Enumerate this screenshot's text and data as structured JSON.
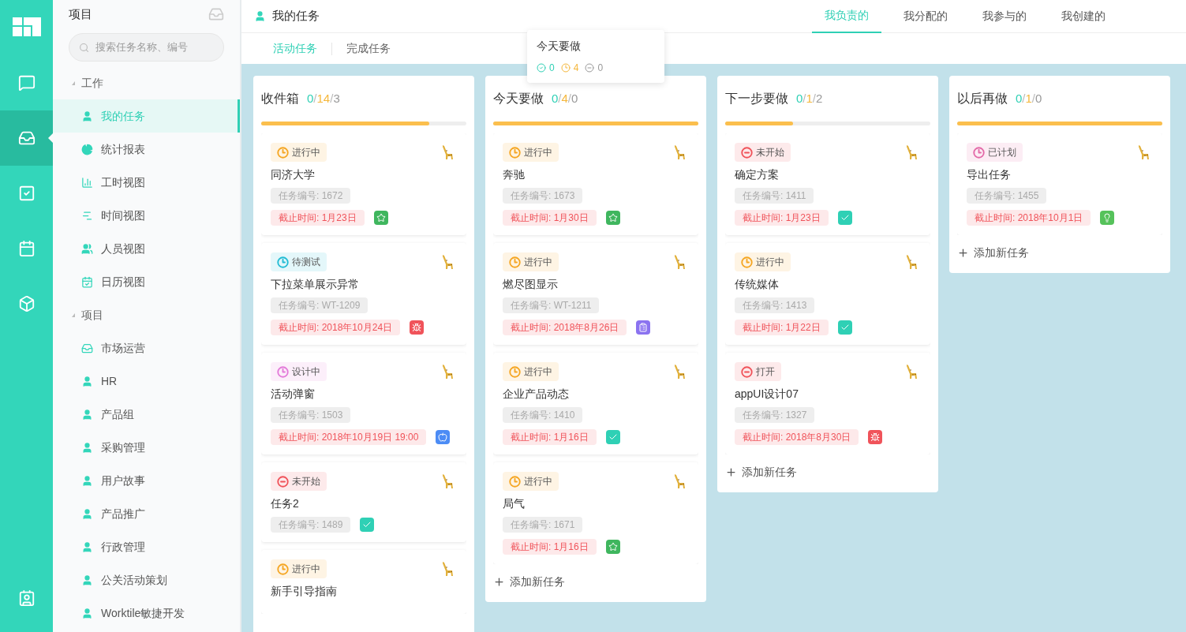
{
  "rail": {
    "items": [
      {
        "kind": "chat",
        "selected": false
      },
      {
        "kind": "inbox",
        "selected": true
      },
      {
        "kind": "task",
        "selected": false
      },
      {
        "kind": "calendar",
        "selected": false
      },
      {
        "kind": "box",
        "selected": false
      }
    ],
    "bottom": {
      "kind": "contacts"
    }
  },
  "sidebar": {
    "title": "项目",
    "search": {
      "placeholder": "搜索任务名称、编号"
    },
    "groups": [
      {
        "label": "工作",
        "expanded": true,
        "children": [
          {
            "label": "我的任务",
            "kind": "user",
            "selected": true
          },
          {
            "label": "统计报表",
            "kind": "pie",
            "selected": false
          },
          {
            "label": "工时视图",
            "kind": "bars",
            "selected": false
          },
          {
            "label": "时间视图",
            "kind": "gantt",
            "selected": false
          },
          {
            "label": "人员视图",
            "kind": "users",
            "selected": false
          },
          {
            "label": "日历视图",
            "kind": "calendar",
            "selected": false
          }
        ]
      },
      {
        "label": "项目",
        "expanded": true,
        "children": [
          {
            "label": "市场运营",
            "kind": "inbox",
            "selected": false
          },
          {
            "label": "HR",
            "kind": "project",
            "selected": false
          },
          {
            "label": "产品组",
            "kind": "project",
            "selected": false
          },
          {
            "label": "采购管理",
            "kind": "project",
            "selected": false
          },
          {
            "label": "用户故事",
            "kind": "project",
            "selected": false
          },
          {
            "label": "产品推广",
            "kind": "project",
            "selected": false
          },
          {
            "label": "行政管理",
            "kind": "project",
            "selected": false
          },
          {
            "label": "公关活动策划",
            "kind": "project",
            "selected": false
          },
          {
            "label": "Worktile敏捷开发",
            "kind": "project",
            "selected": false
          }
        ]
      }
    ]
  },
  "header": {
    "title": "我的任务",
    "tabs": [
      {
        "label": "我负责的",
        "selected": true
      },
      {
        "label": "我分配的",
        "selected": false
      },
      {
        "label": "我参与的",
        "selected": false
      },
      {
        "label": "我创建的",
        "selected": false
      }
    ],
    "subtabs": [
      {
        "label": "活动任务",
        "selected": true
      },
      {
        "label": "完成任务",
        "selected": false
      }
    ]
  },
  "tooltip": {
    "title": "今天要做",
    "done": "0",
    "doing": "4",
    "todo": "0"
  },
  "columns": [
    {
      "title": "收件箱",
      "done": "0",
      "separator": "/",
      "doing": "14",
      "todo": "3",
      "level": 0.82,
      "tasks": [
        {
          "status": {
            "label": "进行中",
            "kind": "clock",
            "color": "#f5a623"
          },
          "title": "同济大学",
          "number": "任务编号: 1672",
          "due": "截止时间: 1月23日",
          "kind": "star"
        },
        {
          "status": {
            "label": "待测试",
            "kind": "clock",
            "color": "#22bcd4"
          },
          "title": "下拉菜单展示异常",
          "number": "任务编号: WT-1209",
          "due": "截止时间: 2018年10月24日",
          "kind": "bug"
        },
        {
          "status": {
            "label": "设计中",
            "kind": "clock",
            "color": "#e37ad9"
          },
          "title": "活动弹窗",
          "number": "任务编号: 1503",
          "due": "截止时间: 2018年10月19日 19:00",
          "kind": "apple"
        },
        {
          "status": {
            "label": "未开始",
            "kind": "minus",
            "color": "#f0535a"
          },
          "title": "任务2",
          "number": "任务编号: 1489",
          "kind": "check"
        },
        {
          "status": {
            "label": "进行中",
            "kind": "clock",
            "color": "#f5a623"
          },
          "title": "新手引导指南"
        }
      ]
    },
    {
      "title": "今天要做",
      "done": "0",
      "separator": "/",
      "doing": "4",
      "todo": "0",
      "level": 1,
      "add": "添加新任务",
      "tasks": [
        {
          "status": {
            "label": "进行中",
            "kind": "clock",
            "color": "#f5a623"
          },
          "title": "奔驰",
          "number": "任务编号: 1673",
          "due": "截止时间: 1月30日",
          "kind": "star"
        },
        {
          "status": {
            "label": "进行中",
            "kind": "clock",
            "color": "#f5a623"
          },
          "title": "燃尽图显示",
          "number": "任务编号: WT-1211",
          "due": "截止时间: 2018年8月26日",
          "kind": "clipboard"
        },
        {
          "status": {
            "label": "进行中",
            "kind": "clock",
            "color": "#f5a623"
          },
          "title": "企业产品动态",
          "number": "任务编号: 1410",
          "due": "截止时间: 1月16日",
          "kind": "check"
        },
        {
          "status": {
            "label": "进行中",
            "kind": "clock",
            "color": "#f5a623"
          },
          "title": "局气",
          "number": "任务编号: 1671",
          "due": "截止时间: 1月16日",
          "kind": "star"
        }
      ]
    },
    {
      "title": "下一步要做",
      "done": "0",
      "separator": "/",
      "doing": "1",
      "todo": "2",
      "level": 0.33,
      "add": "添加新任务",
      "tasks": [
        {
          "status": {
            "label": "未开始",
            "kind": "minus",
            "color": "#f0535a"
          },
          "title": "确定方案",
          "number": "任务编号: 1411",
          "due": "截止时间: 1月23日",
          "kind": "check"
        },
        {
          "status": {
            "label": "进行中",
            "kind": "clock",
            "color": "#f5a623"
          },
          "title": "传统媒体",
          "number": "任务编号: 1413",
          "due": "截止时间: 1月22日",
          "kind": "check"
        },
        {
          "status": {
            "label": "打开",
            "kind": "minus",
            "color": "#f0535a"
          },
          "title": "appUI设计07",
          "number": "任务编号: 1327",
          "due": "截止时间: 2018年8月30日",
          "kind": "bug"
        }
      ]
    },
    {
      "title": "以后再做",
      "done": "0",
      "separator": "/",
      "doing": "1",
      "todo": "0",
      "level": 1,
      "add": "添加新任务",
      "tasks": [
        {
          "status": {
            "label": "已计划",
            "kind": "clock",
            "color": "#e36aa8"
          },
          "title": "导出任务",
          "number": "任务编号: 1455",
          "due": "截止时间: 2018年10月1日",
          "kind": "bulb"
        }
      ]
    }
  ]
}
